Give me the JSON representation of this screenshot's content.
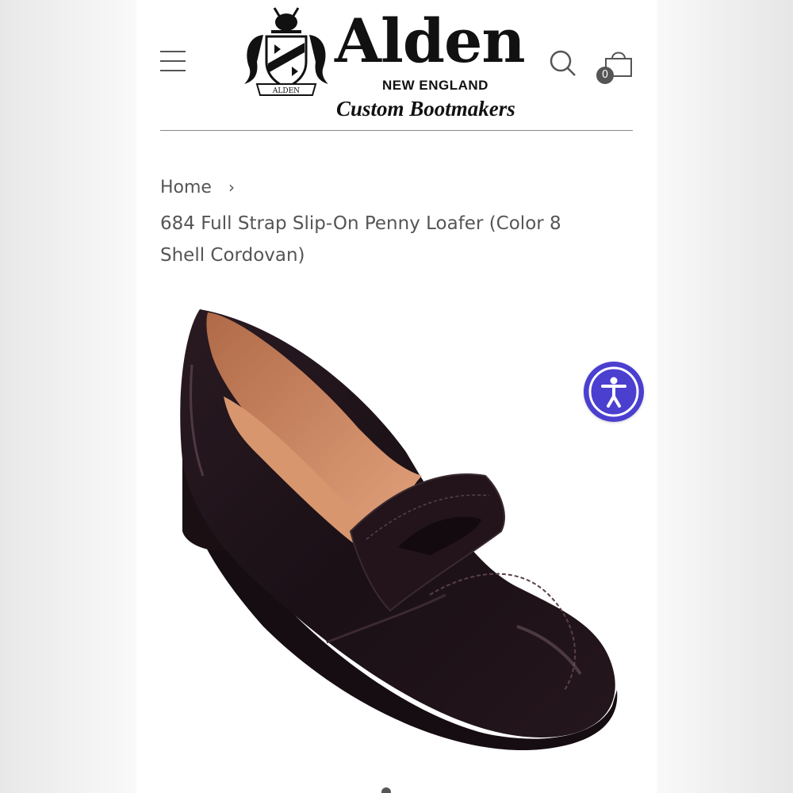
{
  "header": {
    "brand_name": "Alden",
    "brand_sub": "NEW ENGLAND",
    "brand_tagline": "Custom Bootmakers",
    "crest_ribbon": "ALDEN",
    "cart_count": "0",
    "icons": {
      "menu": "hamburger-icon",
      "search": "search-icon",
      "cart": "shopping-bag-icon",
      "accessibility": "accessibility-icon"
    }
  },
  "breadcrumb": {
    "home": "Home",
    "separator": "›"
  },
  "product": {
    "title": "684 Full Strap Slip-On Penny Loafer (Color 8 Shell Cordovan)"
  },
  "colors": {
    "accessibility_button": "#4b3fd0",
    "text": "#555555",
    "shoe": "#1e1418"
  }
}
